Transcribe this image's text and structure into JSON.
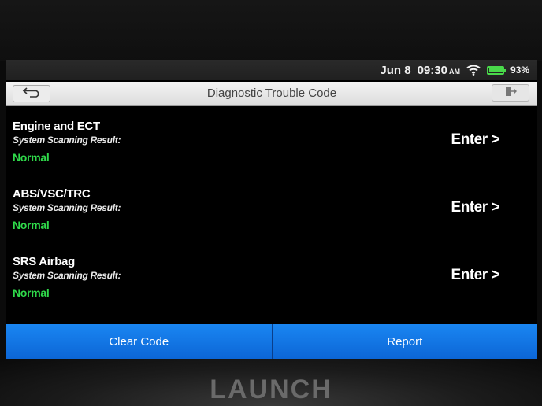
{
  "status_bar": {
    "date": "Jun 8",
    "time": "09:30",
    "ampm": "AM",
    "battery_percent": "93%",
    "battery_level": 0.93
  },
  "header": {
    "title": "Diagnostic Trouble Code",
    "back_icon": "back-arrow-icon",
    "exit_icon": "exit-icon"
  },
  "systems": [
    {
      "name": "Engine and ECT",
      "scan_label": "System Scanning Result:",
      "status": "Normal",
      "enter_label": "Enter >"
    },
    {
      "name": "ABS/VSC/TRC",
      "scan_label": "System Scanning Result:",
      "status": "Normal",
      "enter_label": "Enter >"
    },
    {
      "name": "SRS Airbag",
      "scan_label": "System Scanning Result:",
      "status": "Normal",
      "enter_label": "Enter >"
    }
  ],
  "actions": {
    "clear_code": "Clear Code",
    "report": "Report"
  },
  "device": {
    "brand": "LAUNCH"
  },
  "colors": {
    "accent_blue": "#1a86f2",
    "status_normal": "#2fd94a",
    "battery": "#49d94a"
  }
}
